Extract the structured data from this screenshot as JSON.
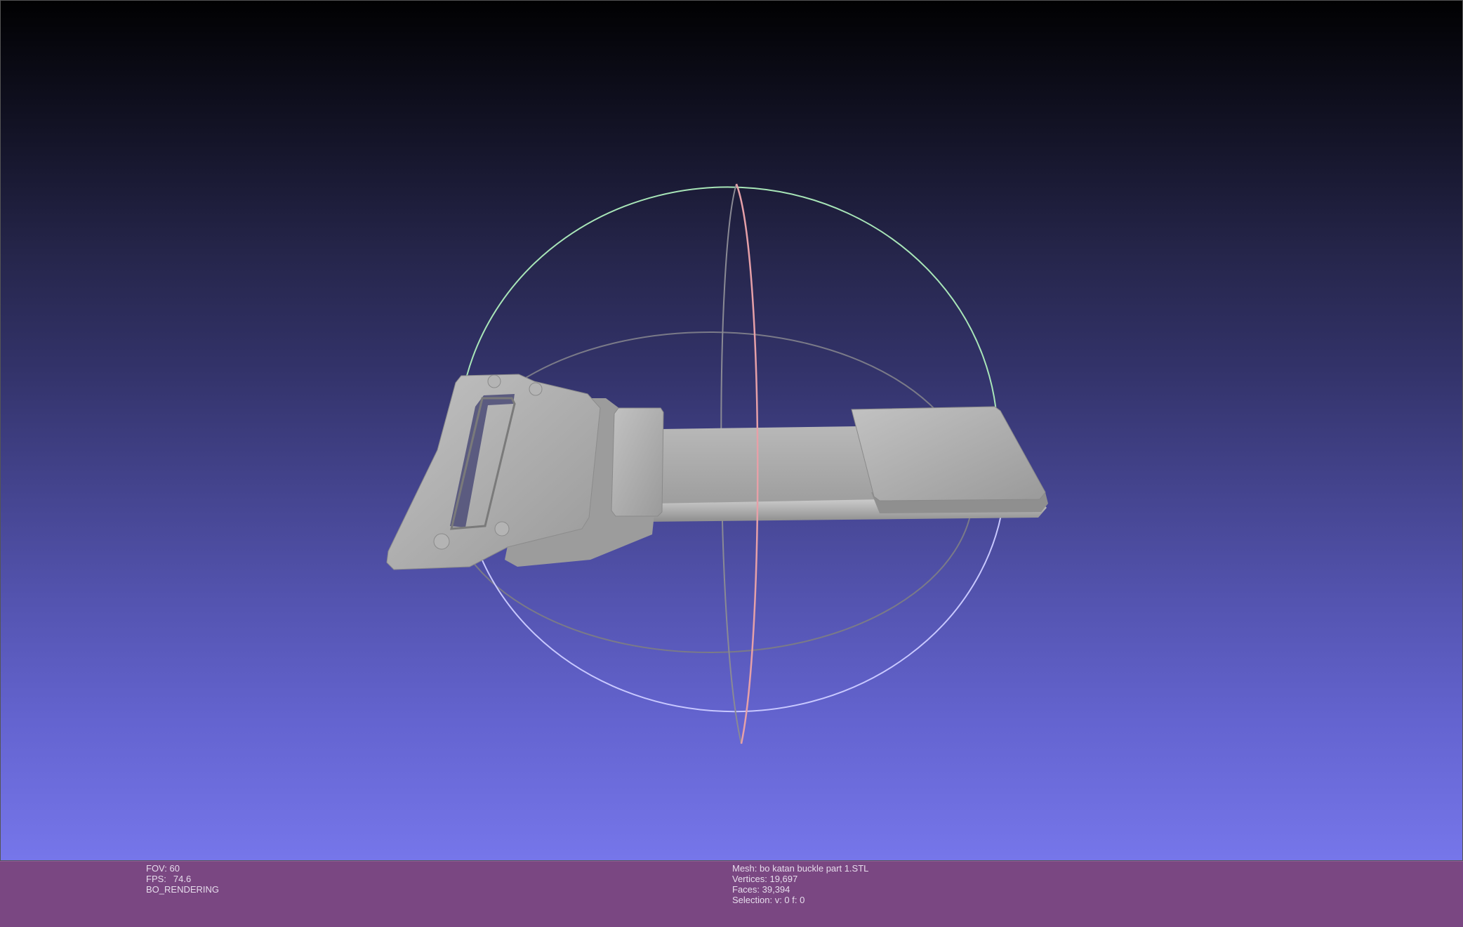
{
  "viewport": {
    "background_top": "#010102",
    "background_bottom": "#7676ea",
    "model_color": "#a6a6a6",
    "trackball_colors": {
      "x_ring": "#e6a0a8",
      "y_ring": "#a0e0b0",
      "z_ring": "#c8c8ff",
      "equator": "#7a7a88"
    }
  },
  "status": {
    "left": {
      "fov": "FOV: 60",
      "fps_label": "FPS:",
      "fps_value": "74.6",
      "mode": "BO_RENDERING"
    },
    "right": {
      "mesh": "Mesh: bo katan buckle part 1.STL",
      "vertices": "Vertices: 19,697",
      "faces": "Faces: 39,394",
      "selection": "Selection: v: 0 f: 0"
    },
    "bar_color": "#7a4782"
  }
}
